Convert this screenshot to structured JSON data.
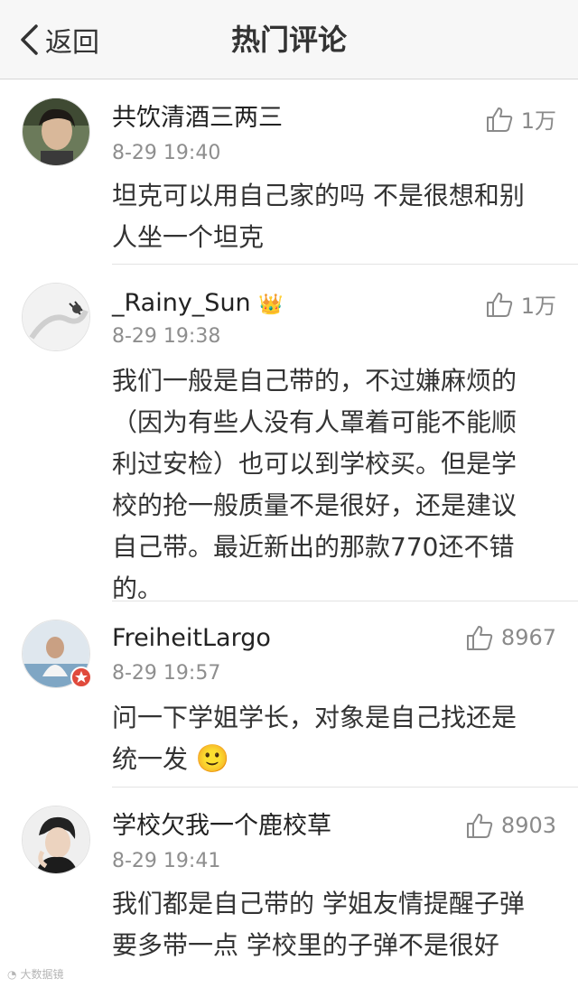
{
  "header": {
    "back_label": "返回",
    "title": "热门评论"
  },
  "comments": [
    {
      "author": "共饮清酒三两三",
      "time": "8-29 19:40",
      "likes": "1万",
      "text_lines": [
        "坦克可以用自己家的吗 不是很想和别",
        "人坐一个坦克"
      ]
    },
    {
      "author": "_Rainy_Sun",
      "badge": "👑",
      "time": "8-29 19:38",
      "likes": "1万",
      "text_lines": [
        "我们一般是自己带的，不过嫌麻烦的",
        "（因为有些人没有人罩着可能不能顺",
        "利过安检）也可以到学校买。但是学",
        "校的抢一般质量不是很好，还是建议",
        "自己带。最近新出的那款770还不错",
        "的。"
      ]
    },
    {
      "author": "FreiheitLargo",
      "time": "8-29 19:57",
      "likes": "8967",
      "text_lines": [
        "问一下学姐学长，对象是自己找还是",
        "统一发"
      ],
      "emoji": "🙂"
    },
    {
      "author": "学校欠我一个鹿校草",
      "time": "8-29 19:41",
      "likes": "8903",
      "text_lines": [
        "我们都是自己带的 学姐友情提醒子弹",
        "要多带一点 学校里的子弹不是很好"
      ]
    }
  ],
  "watermark": "大数据镜",
  "colors": {
    "navbar_bg": "#f7f7f7",
    "text": "#333333",
    "meta": "#8e8e8e",
    "divider": "#e3e3e3",
    "badge_red": "#e04a3c"
  }
}
